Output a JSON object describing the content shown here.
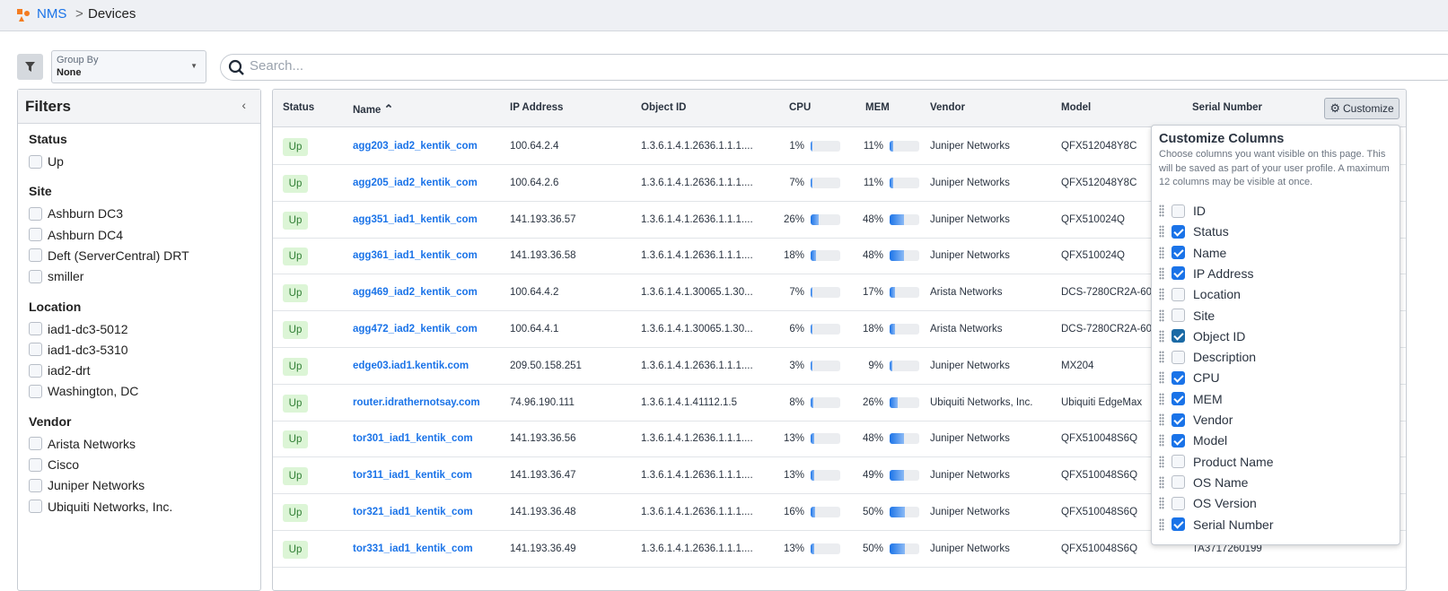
{
  "breadcrumb": {
    "app": "NMS",
    "separator": ">",
    "page": "Devices"
  },
  "toolbar": {
    "group_by_label": "Group By",
    "group_by_value": "None",
    "search_placeholder": "Search..."
  },
  "filters": {
    "title": "Filters",
    "sections": [
      {
        "title": "Status",
        "items": [
          "Up"
        ]
      },
      {
        "title": "Site",
        "items": [
          "Ashburn DC3",
          "Ashburn DC4",
          "Deft (ServerCentral) DRT",
          "smiller"
        ]
      },
      {
        "title": "Location",
        "items": [
          "iad1-dc3-5012",
          "iad1-dc3-5310",
          "iad2-drt",
          "Washington, DC"
        ]
      },
      {
        "title": "Vendor",
        "items": [
          "Arista Networks",
          "Cisco",
          "Juniper Networks",
          "Ubiquiti Networks, Inc."
        ]
      }
    ]
  },
  "table": {
    "columns": [
      "Status",
      "Name",
      "IP Address",
      "Object ID",
      "CPU",
      "MEM",
      "Vendor",
      "Model",
      "Serial Number"
    ],
    "sort_indicator": "^",
    "rows": [
      {
        "status": "Up",
        "name": "agg203_iad2_kentik_com",
        "ip": "100.64.2.4",
        "oid": "1.3.6.1.4.1.2636.1.1.1....",
        "cpu": 1,
        "mem": 11,
        "vendor": "Juniper Networks",
        "model": "QFX512048Y8C",
        "serial": ""
      },
      {
        "status": "Up",
        "name": "agg205_iad2_kentik_com",
        "ip": "100.64.2.6",
        "oid": "1.3.6.1.4.1.2636.1.1.1....",
        "cpu": 7,
        "mem": 11,
        "vendor": "Juniper Networks",
        "model": "QFX512048Y8C",
        "serial": ""
      },
      {
        "status": "Up",
        "name": "agg351_iad1_kentik_com",
        "ip": "141.193.36.57",
        "oid": "1.3.6.1.4.1.2636.1.1.1....",
        "cpu": 26,
        "mem": 48,
        "vendor": "Juniper Networks",
        "model": "QFX510024Q",
        "serial": ""
      },
      {
        "status": "Up",
        "name": "agg361_iad1_kentik_com",
        "ip": "141.193.36.58",
        "oid": "1.3.6.1.4.1.2636.1.1.1....",
        "cpu": 18,
        "mem": 48,
        "vendor": "Juniper Networks",
        "model": "QFX510024Q",
        "serial": ""
      },
      {
        "status": "Up",
        "name": "agg469_iad2_kentik_com",
        "ip": "100.64.4.2",
        "oid": "1.3.6.1.4.1.30065.1.30...",
        "cpu": 7,
        "mem": 17,
        "vendor": "Arista Networks",
        "model": "DCS-7280CR2A-60",
        "serial": ""
      },
      {
        "status": "Up",
        "name": "agg472_iad2_kentik_com",
        "ip": "100.64.4.1",
        "oid": "1.3.6.1.4.1.30065.1.30...",
        "cpu": 6,
        "mem": 18,
        "vendor": "Arista Networks",
        "model": "DCS-7280CR2A-60",
        "serial": ""
      },
      {
        "status": "Up",
        "name": "edge03.iad1.kentik.com",
        "ip": "209.50.158.251",
        "oid": "1.3.6.1.4.1.2636.1.1.1....",
        "cpu": 3,
        "mem": 9,
        "vendor": "Juniper Networks",
        "model": "MX204",
        "serial": ""
      },
      {
        "status": "Up",
        "name": "router.idrathernotsay.com",
        "ip": "74.96.190.111",
        "oid": "1.3.6.1.4.1.41112.1.5",
        "cpu": 8,
        "mem": 26,
        "vendor": "Ubiquiti Networks, Inc.",
        "model": "Ubiquiti EdgeMax",
        "serial": ""
      },
      {
        "status": "Up",
        "name": "tor301_iad1_kentik_com",
        "ip": "141.193.36.56",
        "oid": "1.3.6.1.4.1.2636.1.1.1....",
        "cpu": 13,
        "mem": 48,
        "vendor": "Juniper Networks",
        "model": "QFX510048S6Q",
        "serial": ""
      },
      {
        "status": "Up",
        "name": "tor311_iad1_kentik_com",
        "ip": "141.193.36.47",
        "oid": "1.3.6.1.4.1.2636.1.1.1....",
        "cpu": 13,
        "mem": 49,
        "vendor": "Juniper Networks",
        "model": "QFX510048S6Q",
        "serial": ""
      },
      {
        "status": "Up",
        "name": "tor321_iad1_kentik_com",
        "ip": "141.193.36.48",
        "oid": "1.3.6.1.4.1.2636.1.1.1....",
        "cpu": 16,
        "mem": 50,
        "vendor": "Juniper Networks",
        "model": "QFX510048S6Q",
        "serial": ""
      },
      {
        "status": "Up",
        "name": "tor331_iad1_kentik_com",
        "ip": "141.193.36.49",
        "oid": "1.3.6.1.4.1.2636.1.1.1....",
        "cpu": 13,
        "mem": 50,
        "vendor": "Juniper Networks",
        "model": "QFX510048S6Q",
        "serial": "TA3717260199"
      }
    ]
  },
  "customize": {
    "button_label": "Customize",
    "title": "Customize Columns",
    "description": "Choose columns you want visible on this page. This will be saved as part of your user profile. A maximum 12 columns may be visible at once.",
    "columns": [
      {
        "label": "ID",
        "checked": false
      },
      {
        "label": "Status",
        "checked": true
      },
      {
        "label": "Name",
        "checked": true
      },
      {
        "label": "IP Address",
        "checked": true
      },
      {
        "label": "Location",
        "checked": false
      },
      {
        "label": "Site",
        "checked": false
      },
      {
        "label": "Object ID",
        "checked": true
      },
      {
        "label": "Description",
        "checked": false
      },
      {
        "label": "CPU",
        "checked": true
      },
      {
        "label": "MEM",
        "checked": true
      },
      {
        "label": "Vendor",
        "checked": true
      },
      {
        "label": "Model",
        "checked": true
      },
      {
        "label": "Product Name",
        "checked": false
      },
      {
        "label": "OS Name",
        "checked": false
      },
      {
        "label": "OS Version",
        "checked": false
      },
      {
        "label": "Serial Number",
        "checked": true
      }
    ]
  },
  "colors": {
    "accent": "#1a73e8",
    "status_up_bg": "#dcf5d6",
    "status_up_text": "#2e7d32",
    "logo": "#f47c20"
  }
}
